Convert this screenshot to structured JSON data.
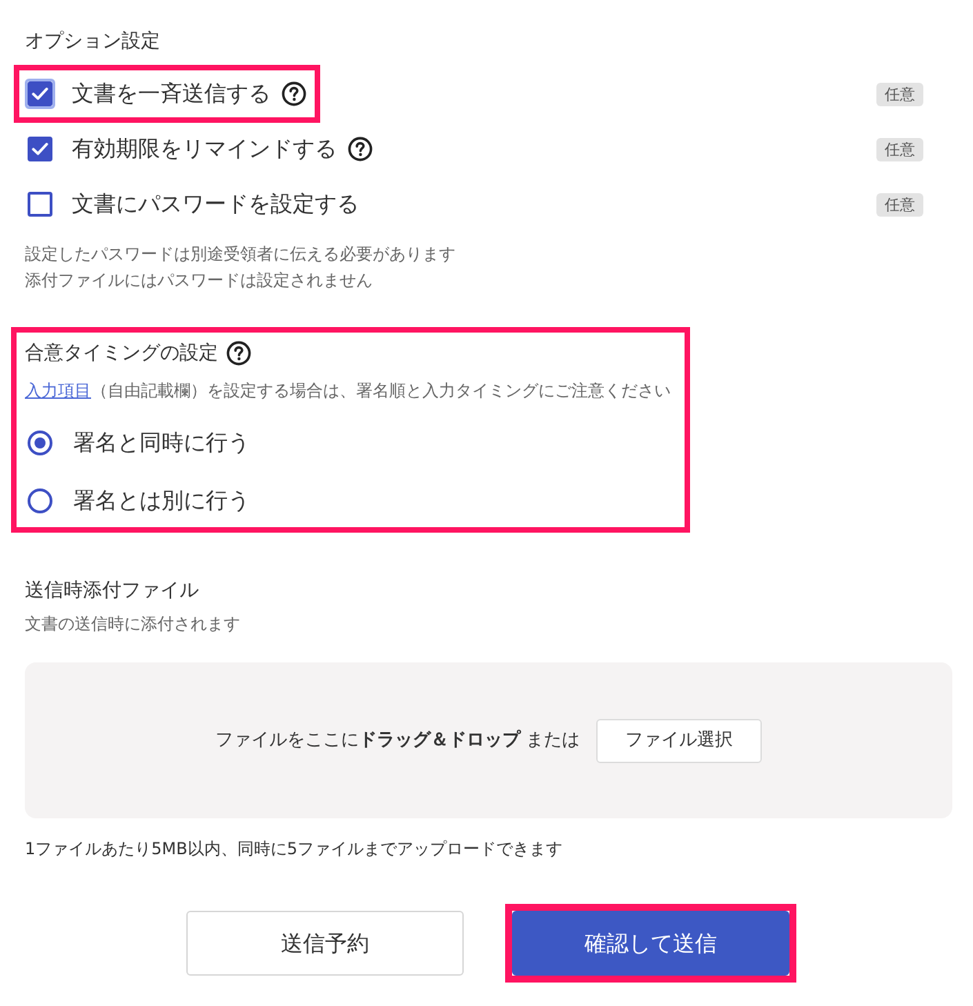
{
  "options_section": {
    "title": "オプション設定",
    "options": [
      {
        "label": "文書を一斉送信する",
        "checked": true,
        "focused": true,
        "help": true,
        "highlighted": true,
        "badge": "任意"
      },
      {
        "label": "有効期限をリマインドする",
        "checked": true,
        "focused": false,
        "help": true,
        "highlighted": false,
        "badge": "任意"
      },
      {
        "label": "文書にパスワードを設定する",
        "checked": false,
        "focused": false,
        "help": false,
        "highlighted": false,
        "badge": "任意"
      }
    ],
    "notes": [
      "設定したパスワードは別途受領者に伝える必要があります",
      "添付ファイルにはパスワードは設定されません"
    ]
  },
  "timing_section": {
    "title": "合意タイミングの設定",
    "help": true,
    "highlighted": true,
    "link": "入力項目",
    "description": "（自由記載欄）を設定する場合は、署名順と入力タイミングにご注意ください",
    "choices": [
      {
        "label": "署名と同時に行う",
        "selected": true
      },
      {
        "label": "署名とは別に行う",
        "selected": false
      }
    ]
  },
  "attachment_section": {
    "title": "送信時添付ファイル",
    "subtitle": "文書の送信時に添付されます",
    "dropzone_text": "ファイルをここに**ドラッグ＆ドロップ** または",
    "select_button": "ファイル選択",
    "limit_note": "1ファイルあたり5MB以内、同時に5ファイルまでアップロードできます"
  },
  "buttons": [
    {
      "label": "送信予約",
      "kind": "secondary",
      "highlighted": false
    },
    {
      "label": "確認して送信",
      "kind": "primary",
      "highlighted": true
    }
  ]
}
